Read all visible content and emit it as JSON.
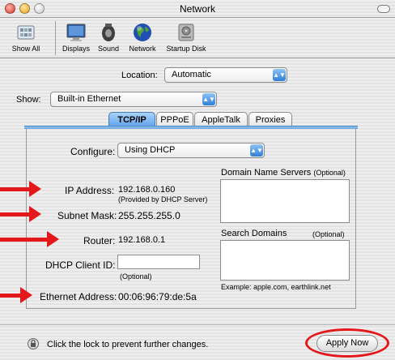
{
  "window": {
    "title": "Network"
  },
  "toolbar": {
    "items": [
      {
        "label": "Show All",
        "icon": "show-all-icon"
      },
      {
        "label": "Displays",
        "icon": "display-icon"
      },
      {
        "label": "Sound",
        "icon": "speaker-icon"
      },
      {
        "label": "Network",
        "icon": "globe-icon"
      },
      {
        "label": "Startup Disk",
        "icon": "disk-icon"
      }
    ]
  },
  "location": {
    "label": "Location:",
    "value": "Automatic"
  },
  "show": {
    "label": "Show:",
    "value": "Built-in Ethernet"
  },
  "tabs": [
    {
      "label": "TCP/IP",
      "active": true
    },
    {
      "label": "PPPoE",
      "active": false
    },
    {
      "label": "AppleTalk",
      "active": false
    },
    {
      "label": "Proxies",
      "active": false
    }
  ],
  "tcpip": {
    "configure_label": "Configure:",
    "configure_value": "Using DHCP",
    "ip_label": "IP Address:",
    "ip_value": "192.168.0.160",
    "ip_note": "(Provided by DHCP Server)",
    "subnet_label": "Subnet Mask:",
    "subnet_value": "255.255.255.0",
    "router_label": "Router:",
    "router_value": "192.168.0.1",
    "dhcp_client_label": "DHCP Client ID:",
    "dhcp_client_value": "",
    "dhcp_client_note": "(Optional)",
    "ethernet_label": "Ethernet Address:",
    "ethernet_value": "00:06:96:79:de:5a",
    "dns_label": "Domain Name Servers",
    "dns_optional": "(Optional)",
    "search_label": "Search Domains",
    "search_optional": "(Optional)",
    "example": "Example: apple.com, earthlink.net"
  },
  "footer": {
    "lock_text": "Click the lock to prevent further changes.",
    "apply_label": "Apply Now"
  },
  "colors": {
    "annotation_red": "#e4171b",
    "tab_active_blue": "#5a9ee8",
    "popup_arrow_blue": "#2f7fd6"
  }
}
